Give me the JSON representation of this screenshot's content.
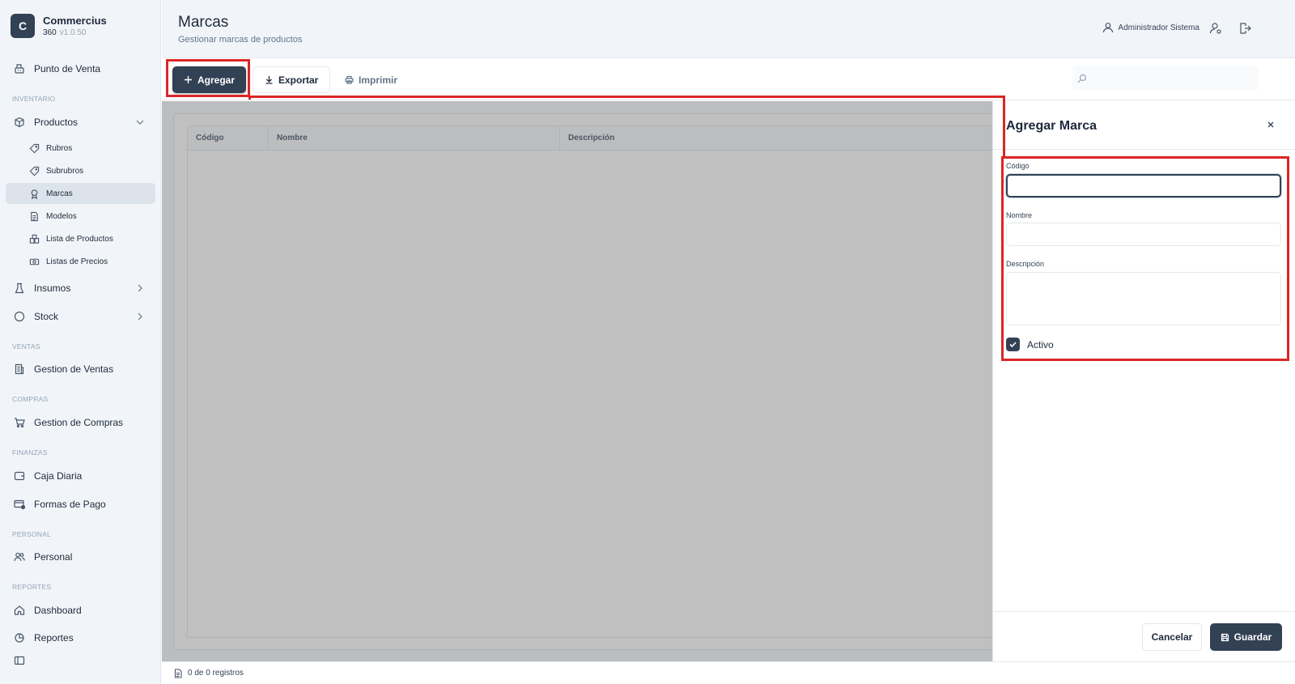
{
  "brand": {
    "initial": "C",
    "name": "Commercius",
    "edition": "360",
    "version": "v1.0.50"
  },
  "sidebar": {
    "top_item": {
      "label": "Punto de Venta",
      "icon": "cash-register-icon"
    },
    "sections": {
      "inventario": "INVENTARIO",
      "ventas": "VENTAS",
      "compras": "COMPRAS",
      "finanzas": "FINANZAS",
      "personal": "PERSONAL",
      "reportes": "REPORTES"
    },
    "items": {
      "productos": "Productos",
      "rubros": "Rubros",
      "subrubros": "Subrubros",
      "marcas": "Marcas",
      "modelos": "Modelos",
      "lista_productos": "Lista de Productos",
      "listas_precios": "Listas de Precios",
      "insumos": "Insumos",
      "stock": "Stock",
      "gestion_ventas": "Gestion de Ventas",
      "gestion_compras": "Gestion de Compras",
      "caja_diaria": "Caja Diaria",
      "formas_pago": "Formas de Pago",
      "personal": "Personal",
      "dashboard": "Dashboard",
      "reportes": "Reportes"
    }
  },
  "header": {
    "title": "Marcas",
    "subtitle": "Gestionar marcas de productos",
    "user": "Administrador Sistema"
  },
  "toolbar": {
    "add_label": "Agregar",
    "export_label": "Exportar",
    "print_label": "Imprimir",
    "search_placeholder": ""
  },
  "table": {
    "columns": [
      "Código",
      "Nombre",
      "Descripción"
    ],
    "rows": []
  },
  "footer": {
    "records": "0 de 0 registros"
  },
  "drawer": {
    "title": "Agregar Marca",
    "fields": {
      "codigo_label": "Código",
      "codigo_value": "",
      "nombre_label": "Nombre",
      "nombre_value": "",
      "descripcion_label": "Descripción",
      "descripcion_value": ""
    },
    "activo_label": "Activo",
    "activo_checked": true,
    "cancel_label": "Cancelar",
    "save_label": "Guardar"
  },
  "colors": {
    "primary": "#334155",
    "highlight": "#dc2626",
    "sidebar_bg": "#f1f5f9"
  }
}
